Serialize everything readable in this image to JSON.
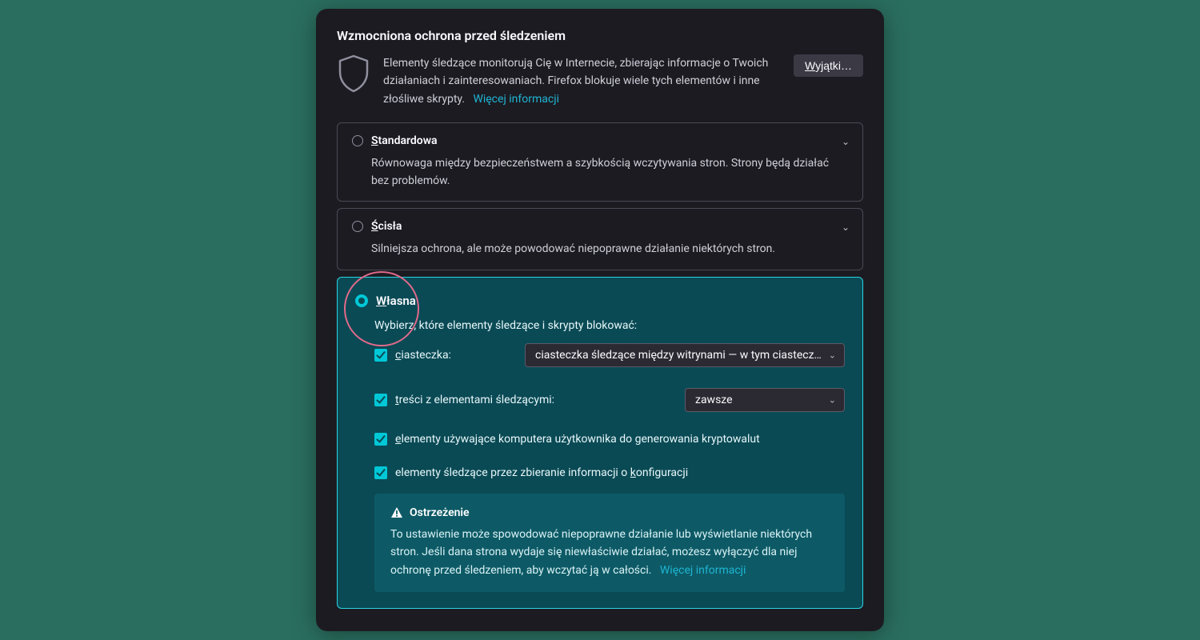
{
  "title": "Wzmocniona ochrona przed śledzeniem",
  "intro": {
    "text": "Elementy śledzące monitorują Cię w Internecie, zbierając informacje o Twoich działaniach i zainteresowaniach. Firefox blokuje wiele tych elementów i inne złośliwe skrypty.",
    "more_link": "Więcej informacji",
    "exceptions_btn_prefix": "W",
    "exceptions_btn_rest": "yjątki…"
  },
  "options": {
    "standard": {
      "label_prefix": "S",
      "label_rest": "tandardowa",
      "desc": "Równowaga między bezpieczeństwem a szybkością wczytywania stron. Strony będą działać bez problemów."
    },
    "strict": {
      "label_prefix": "Ś",
      "label_rest": "cisła",
      "desc": "Silniejsza ochrona, ale może powodować niepoprawne działanie niektórych stron."
    },
    "custom": {
      "label_prefix": "W",
      "label_rest": "łasna",
      "desc": "Wybierz, które elementy śledzące i skrypty blokować:",
      "cookies": {
        "label_prefix": "c",
        "label_rest": "iasteczka:",
        "selected": "ciasteczka śledzące między witrynami — w tym ciasteczk…"
      },
      "tracking_content": {
        "label_prefix": "t",
        "label_rest": "reści z elementami śledzącymi:",
        "selected": "zawsze"
      },
      "cryptominers": {
        "label_prefix": "e",
        "label_rest": "lementy używające komputera użytkownika do generowania kryptowalut"
      },
      "fingerprinters": {
        "label_pre": "elementy śledzące przez zbieranie informacji o ",
        "label_ul": "k",
        "label_post": "onfiguracji"
      },
      "warning": {
        "title": "Ostrzeżenie",
        "body": "To ustawienie może spowodować niepoprawne działanie lub wyświetlanie niektórych stron. Jeśli dana strona wydaje się niewłaściwie działać, możesz wyłączyć dla niej ochronę przed śledzeniem, aby wczytać ją w całości.",
        "more_link": "Więcej informacji"
      }
    }
  }
}
